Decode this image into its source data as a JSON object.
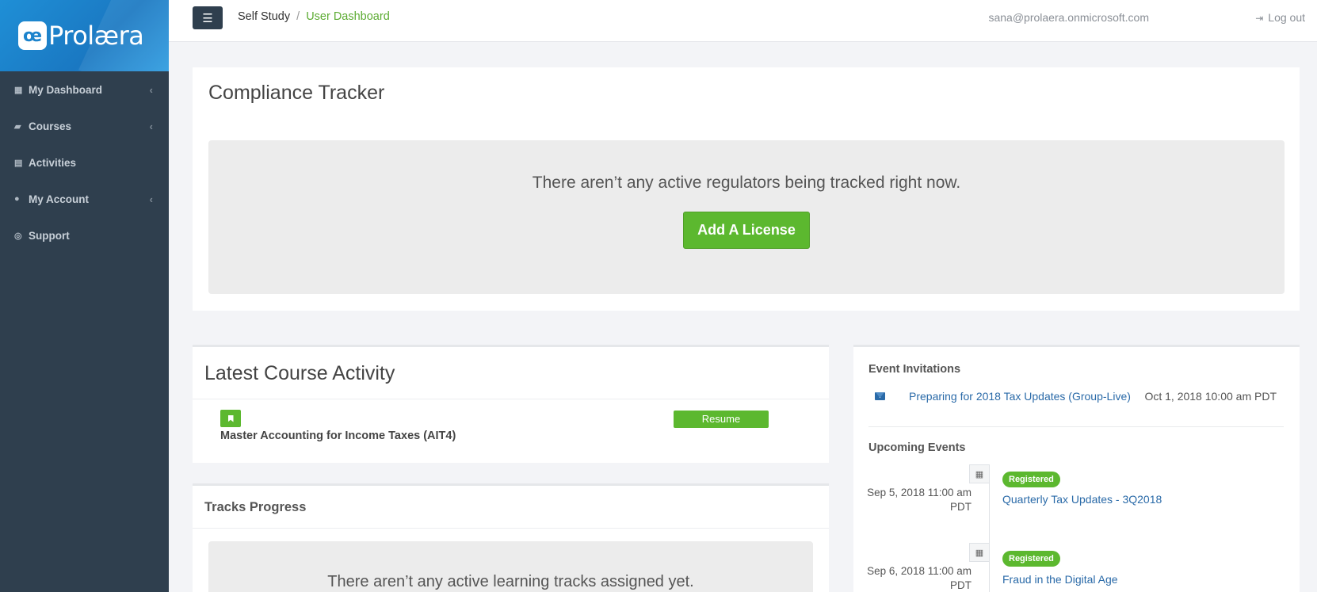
{
  "brand": {
    "badge": "œ",
    "name": "Prolæra"
  },
  "sidebar": {
    "items": [
      {
        "label": "My Dashboard",
        "icon": "dashboard-icon",
        "glyph": "▦",
        "has_chevron": true
      },
      {
        "label": "Courses",
        "icon": "book-icon",
        "glyph": "▰",
        "has_chevron": true
      },
      {
        "label": "Activities",
        "icon": "document-icon",
        "glyph": "▤",
        "has_chevron": false
      },
      {
        "label": "My Account",
        "icon": "user-icon",
        "glyph": "●",
        "has_chevron": true
      },
      {
        "label": "Support",
        "icon": "lifebuoy-icon",
        "glyph": "◎",
        "has_chevron": false
      }
    ]
  },
  "topbar": {
    "menu_icon": "☰",
    "breadcrumb": [
      "Self Study",
      "User Dashboard"
    ],
    "breadcrumb_sep": "/",
    "user_email": "sana@prolaera.onmicrosoft.com",
    "logout_label": "Log out",
    "logout_icon": "⇥"
  },
  "compliance": {
    "title": "Compliance Tracker",
    "empty_text": "There aren’t any active regulators being tracked right now.",
    "add_button": "Add A License"
  },
  "latest_activity": {
    "title": "Latest Course Activity",
    "course_name": "Master Accounting for Income Taxes (AIT4)",
    "resume_label": "Resume"
  },
  "tracks": {
    "title": "Tracks Progress",
    "empty_text": "There aren’t any active learning tracks assigned yet."
  },
  "event_invitations": {
    "title": "Event Invitations",
    "items": [
      {
        "title": "Preparing for 2018 Tax Updates (Group-Live)",
        "date": "Oct 1, 2018 10:00 am PDT"
      }
    ]
  },
  "upcoming_events": {
    "title": "Upcoming Events",
    "items": [
      {
        "date_line1": "Sep 5, 2018 11:00 am",
        "date_line2": "PDT",
        "status": "Registered",
        "title": "Quarterly Tax Updates - 3Q2018"
      },
      {
        "date_line1": "Sep 6, 2018 11:00 am",
        "date_line2": "PDT",
        "status": "Registered",
        "title": "Fraud in the Digital Age"
      }
    ]
  },
  "colors": {
    "sidebar_bg": "#2f3f4e",
    "brand_blue": "#1c83cc",
    "accent_green": "#5cb82f",
    "link_blue": "#2a6aa8"
  }
}
